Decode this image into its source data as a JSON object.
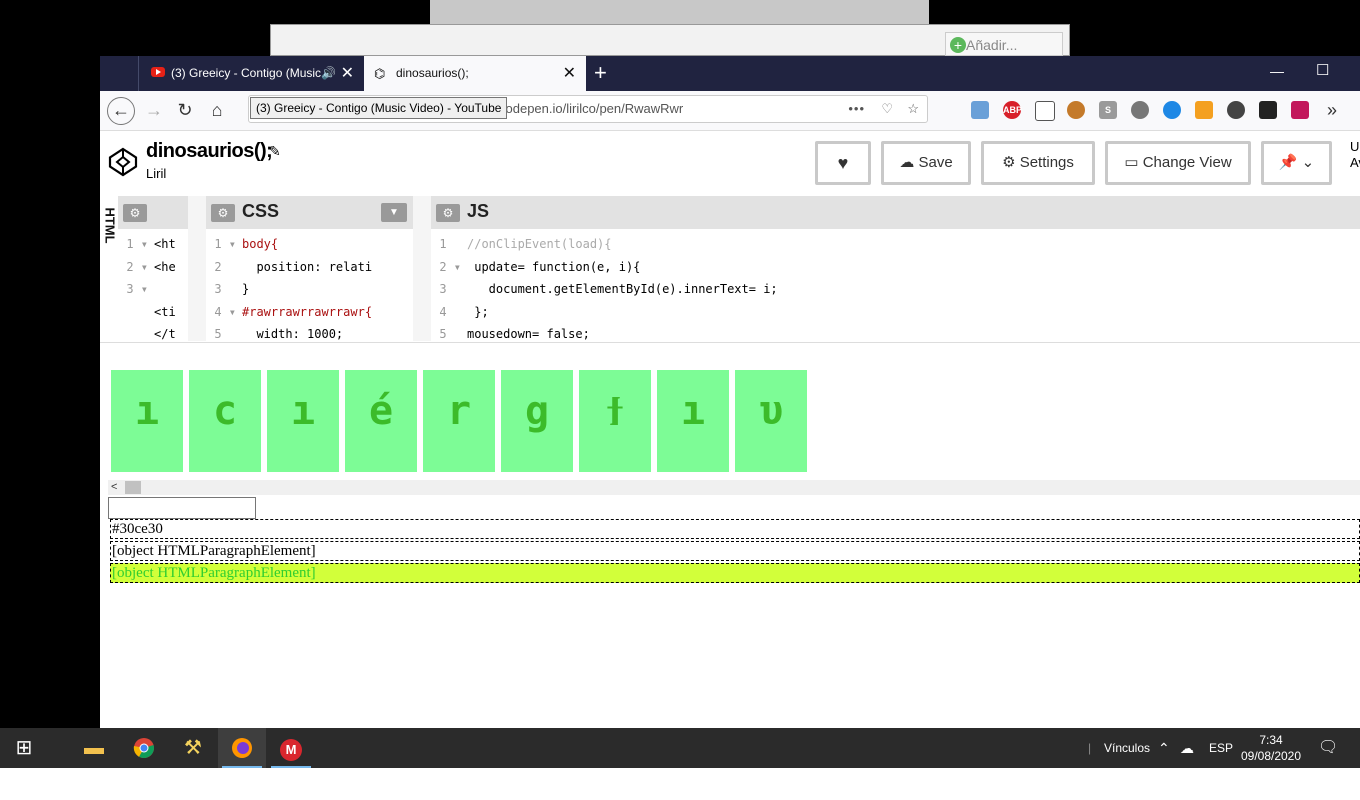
{
  "background_window": {
    "button_label": "Añadir..."
  },
  "browser": {
    "tabs": [
      {
        "title": "(3) Greeicy - Contigo (Music Video) - YouTube",
        "short_title": "(3) Greeicy - Contigo (Music"
      },
      {
        "title": "dinosaurios();"
      }
    ],
    "url_visible": "codepen.io/lirilco/pen/RwawRwr",
    "tooltip": "(3) Greeicy - Contigo (Music Video) - YouTube",
    "extensions": [
      "ABP"
    ]
  },
  "codepen": {
    "title": "dinosaurios();",
    "author": "Liril",
    "buttons": {
      "save": "Save",
      "settings": "Settings",
      "change_view": "Change View"
    },
    "edge_text": "U\nAv",
    "panes": {
      "html": "HTML",
      "css": "CSS",
      "js": "JS"
    },
    "html_code": [
      "1",
      "2",
      "3"
    ],
    "html_lines": [
      "<ht",
      "<he",
      "",
      "<ti",
      "</t"
    ],
    "css_lines": [
      "body{",
      "  position: relati",
      "}",
      "#rawrrawrrawrrawr{",
      "  width: 1000;"
    ],
    "js_lines": [
      "//onClipEvent(load){",
      " update= function(e, i){",
      "   document.getElementById(e).innerText= i;",
      " };",
      "mousedown= false;"
    ],
    "tiles": [
      "ı",
      "c",
      "ı",
      "é",
      "r",
      "g",
      "ϯ",
      "ı",
      "υ"
    ],
    "outputs": [
      "#30ce30",
      "[object HTMLParagraphElement]",
      "[object HTMLParagraphElement]"
    ],
    "highlight_color": "#d2ff3a",
    "highlight_text_color": "#30ce30"
  },
  "taskbar": {
    "tray_label": "Vínculos",
    "language": "ESP",
    "time": "7:34",
    "date": "09/08/2020"
  }
}
